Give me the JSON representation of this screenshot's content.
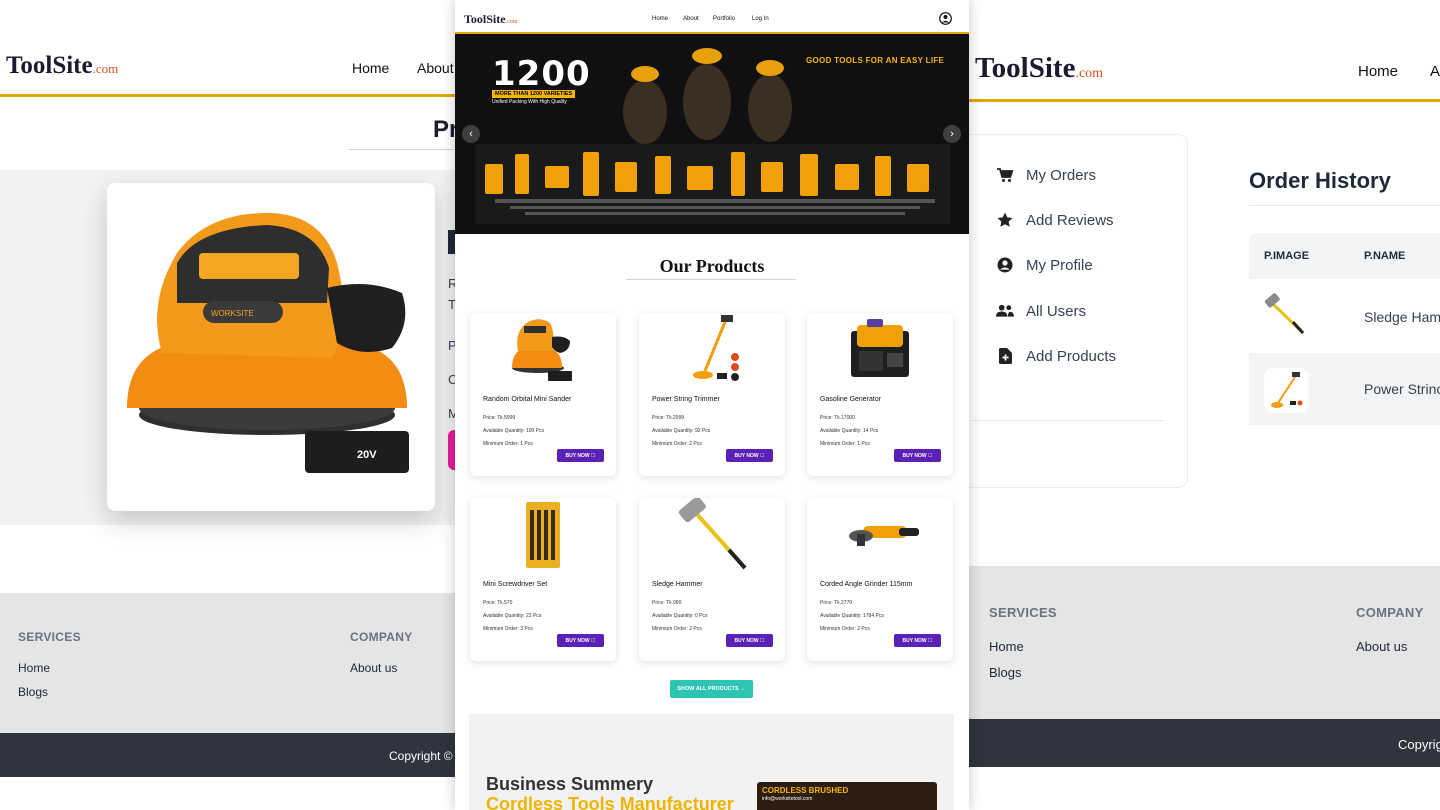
{
  "brand": {
    "name": "ToolSite",
    "suffix": ".com"
  },
  "left": {
    "nav": {
      "home": "Home",
      "about": "About"
    },
    "heading_fragment": "Pr",
    "detail_fragments": [
      "R",
      "T",
      "P",
      "C",
      "M"
    ],
    "footer": {
      "services": "SERVICES",
      "company": "COMPANY",
      "home": "Home",
      "blogs": "Blogs",
      "about_us": "About us"
    },
    "copyright": "Copyright ©"
  },
  "center": {
    "nav": {
      "home": "Home",
      "about": "About",
      "portfolio": "Portfolio",
      "login": "Log In"
    },
    "hero": {
      "big_number": "1200",
      "varieties": "MORE THAN 1200 VARIETIES",
      "sub": "Unified Packing With High Quality",
      "slogan": "GOOD TOOLS FOR AN EASY LIFE",
      "prev": "‹",
      "next": "›"
    },
    "section_title": "Our Products",
    "products": [
      {
        "name": "Random Orbital Mini Sander",
        "price": "Price: Tk.5999",
        "available": "Available Quantity: 100 Pcs",
        "minimum": "Minimum Order: 1 Pcs",
        "buy": "BUY NOW"
      },
      {
        "name": "Power String Trimmer",
        "price": "Price: Tk.2999",
        "available": "Available Quantity: 92 Pcs",
        "minimum": "Minimum Order: 2 Pcs",
        "buy": "BUY NOW"
      },
      {
        "name": "Gasoline Generator",
        "price": "Price: Tk.17000",
        "available": "Available Quantity: 14 Pcs",
        "minimum": "Minimum Order: 1 Pcs",
        "buy": "BUY NOW"
      },
      {
        "name": "Mini Screwdriver Set",
        "price": "Price: Tk.570",
        "available": "Available Quantity: 23 Pcs",
        "minimum": "Minimum Order: 3 Pcs",
        "buy": "BUY NOW"
      },
      {
        "name": "Sledge Hammer",
        "price": "Price: Tk.990",
        "available": "Available Quantity: 0 Pcs",
        "minimum": "Minimum Order: 2 Pcs",
        "buy": "BUY NOW"
      },
      {
        "name": "Corded Angle Grinder 115mm",
        "price": "Price: Tk.2770",
        "available": "Available Quantity: 1784 Pcs",
        "minimum": "Minimum Order: 2 Pcs",
        "buy": "BUY NOW"
      }
    ],
    "show_all": "SHOW ALL PRODUCTS",
    "business": {
      "title": "Business Summery",
      "subtitle": "Cordless Tools Manufacturer",
      "promo_title": "CORDLESS BRUSHED",
      "promo_email": "info@worksitetool.com"
    }
  },
  "right": {
    "nav": {
      "home": "Home",
      "about_fragment": "A"
    },
    "menu": [
      {
        "label": "My Orders",
        "icon": "cart-icon"
      },
      {
        "label": "Add Reviews",
        "icon": "star-icon"
      },
      {
        "label": "My Profile",
        "icon": "user-circle-icon"
      },
      {
        "label": "All Users",
        "icon": "users-icon"
      },
      {
        "label": "Add Products",
        "icon": "file-plus-icon"
      }
    ],
    "title": "Order History",
    "table": {
      "headers": [
        "P.IMAGE",
        "P.NAME"
      ],
      "rows": [
        {
          "name": "Sledge Ham"
        },
        {
          "name": "Power Strinc"
        }
      ]
    },
    "footer": {
      "services": "SERVICES",
      "company": "COMPANY",
      "home": "Home",
      "blogs": "Blogs",
      "about_us": "About us"
    },
    "copyright": "Copyrig"
  },
  "colors": {
    "accent": "#e0a800",
    "buy_button": "#5b21b6",
    "show_all": "#2dc4b2",
    "footer_dark": "#2f343f",
    "brand_com": "#d9531e"
  }
}
